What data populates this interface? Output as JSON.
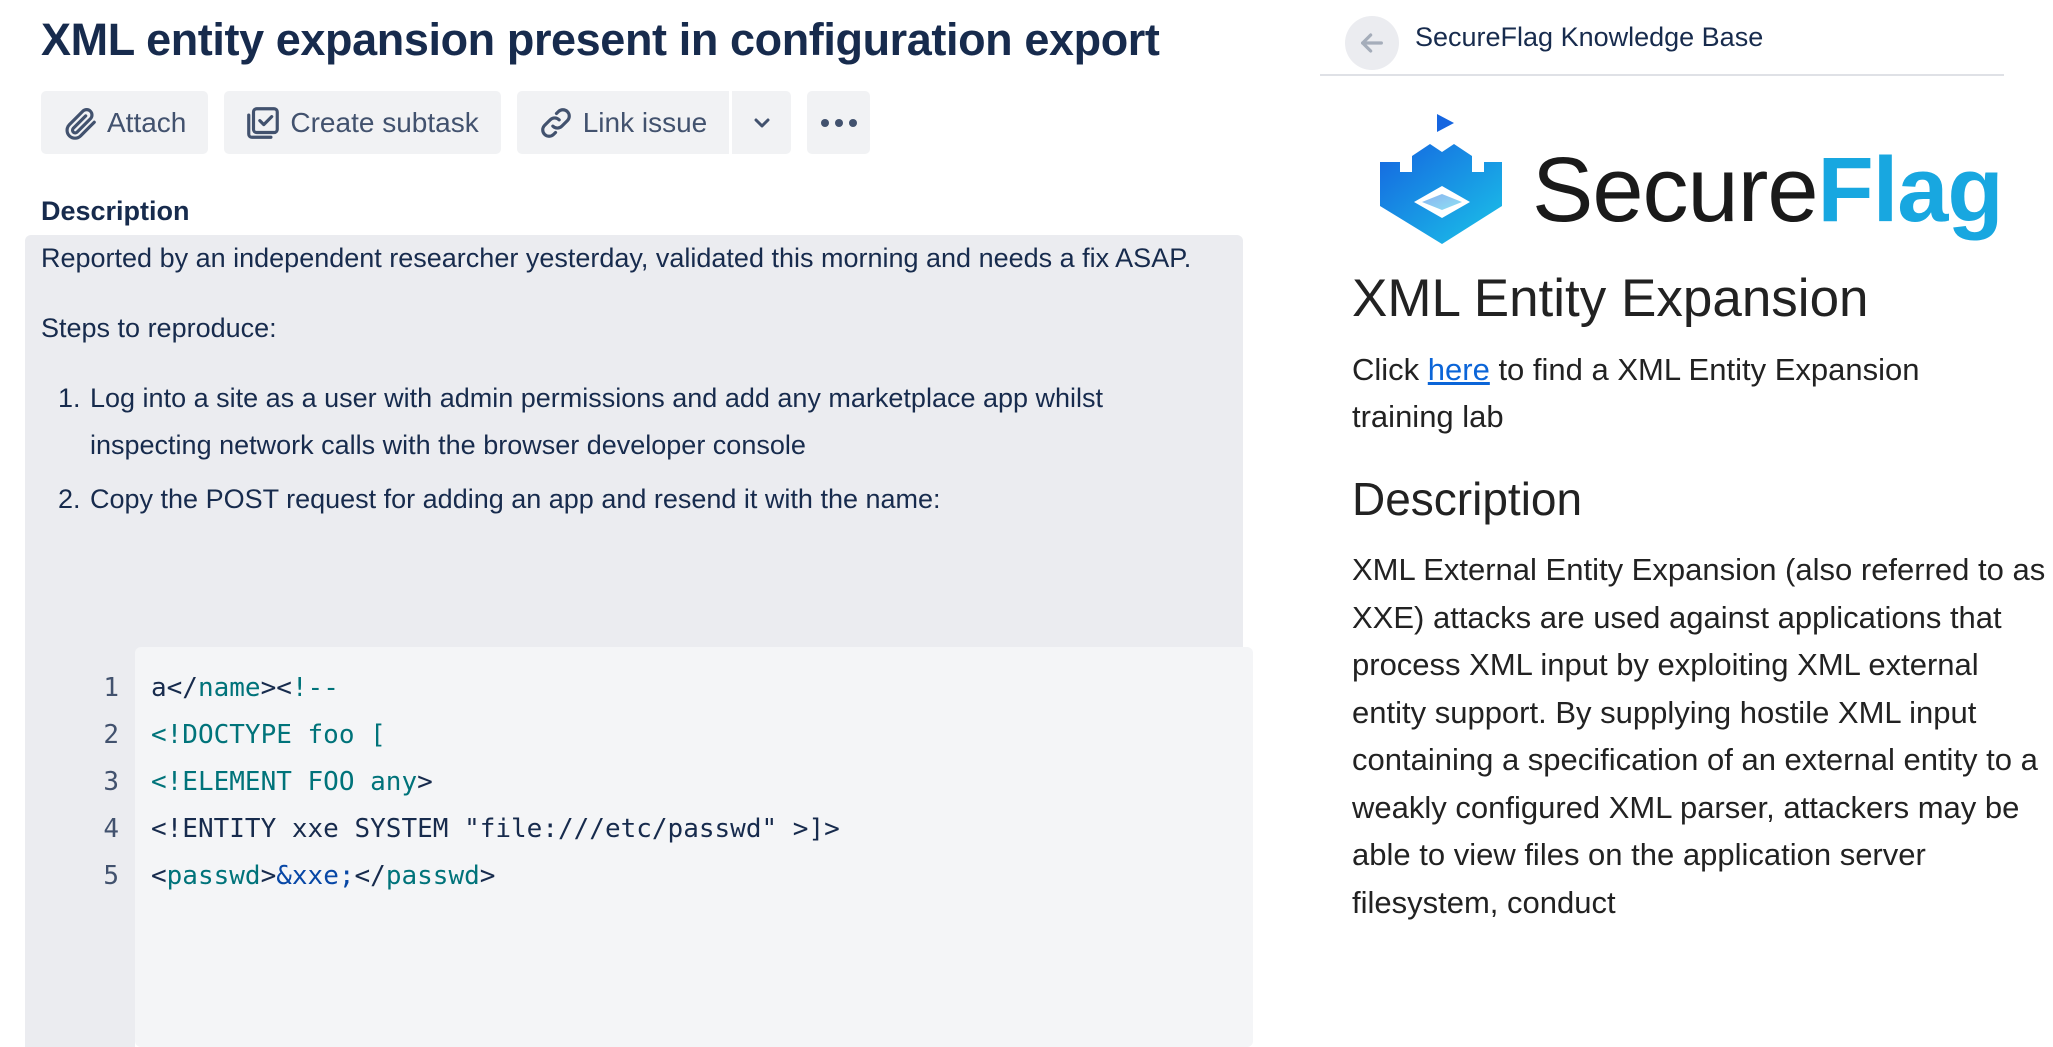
{
  "issue": {
    "title": "XML entity expansion present in configuration export",
    "toolbar": {
      "attach_label": "Attach",
      "create_subtask_label": "Create subtask",
      "link_issue_label": "Link issue"
    },
    "description_heading": "Description",
    "description": {
      "paragraph": "Reported by an independent researcher yesterday, validated this morning and needs a fix ASAP.",
      "steps_intro": "Steps to reproduce:",
      "steps": [
        "Log into a site as a user with admin permissions and add any marketplace app whilst inspecting network calls with the browser developer console",
        "Copy the POST request for adding an app and resend it with the name:"
      ]
    },
    "code": {
      "line_numbers": [
        "1",
        "2",
        "3",
        "4",
        "5"
      ],
      "lines": [
        [
          {
            "t": "a</",
            "c": "plain"
          },
          {
            "t": "name",
            "c": "tag"
          },
          {
            "t": "><",
            "c": "plain"
          },
          {
            "t": "!--",
            "c": "tag"
          }
        ],
        [
          {
            "t": "<!DOCTYPE foo [",
            "c": "tag"
          }
        ],
        [
          {
            "t": "<!ELEMENT FOO any",
            "c": "tag"
          },
          {
            "t": ">",
            "c": "plain"
          }
        ],
        [
          {
            "t": "<!ENTITY xxe SYSTEM \"file:///etc/passwd\" >]>",
            "c": "plain"
          }
        ],
        [
          {
            "t": "<",
            "c": "plain"
          },
          {
            "t": "passwd",
            "c": "tag"
          },
          {
            "t": ">",
            "c": "plain"
          },
          {
            "t": "&xxe;",
            "c": "ent"
          },
          {
            "t": "</",
            "c": "plain"
          },
          {
            "t": "passwd",
            "c": "tag"
          },
          {
            "t": ">",
            "c": "plain"
          }
        ]
      ]
    }
  },
  "knowledge_base": {
    "panel_title": "SecureFlag Knowledge Base",
    "logo": {
      "part1": "Secure",
      "part2": "Flag"
    },
    "heading": "XML Entity Expansion",
    "lead_before": "Click ",
    "lead_link": "here",
    "lead_after": " to find a XML Entity Expansion training lab",
    "description_heading": "Description",
    "description_text": "XML External Entity Expansion (also referred to as XXE) attacks are used against applications that process XML input by exploiting XML external entity support. By supplying hostile XML input containing a specification of an external entity to a weakly configured XML parser, attackers may be able to view files on the application server filesystem, conduct"
  },
  "colors": {
    "code_tag": "#00737a",
    "code_entity": "#0747a6",
    "link": "#0b65d8",
    "brand_blue": "#18a7e0"
  }
}
